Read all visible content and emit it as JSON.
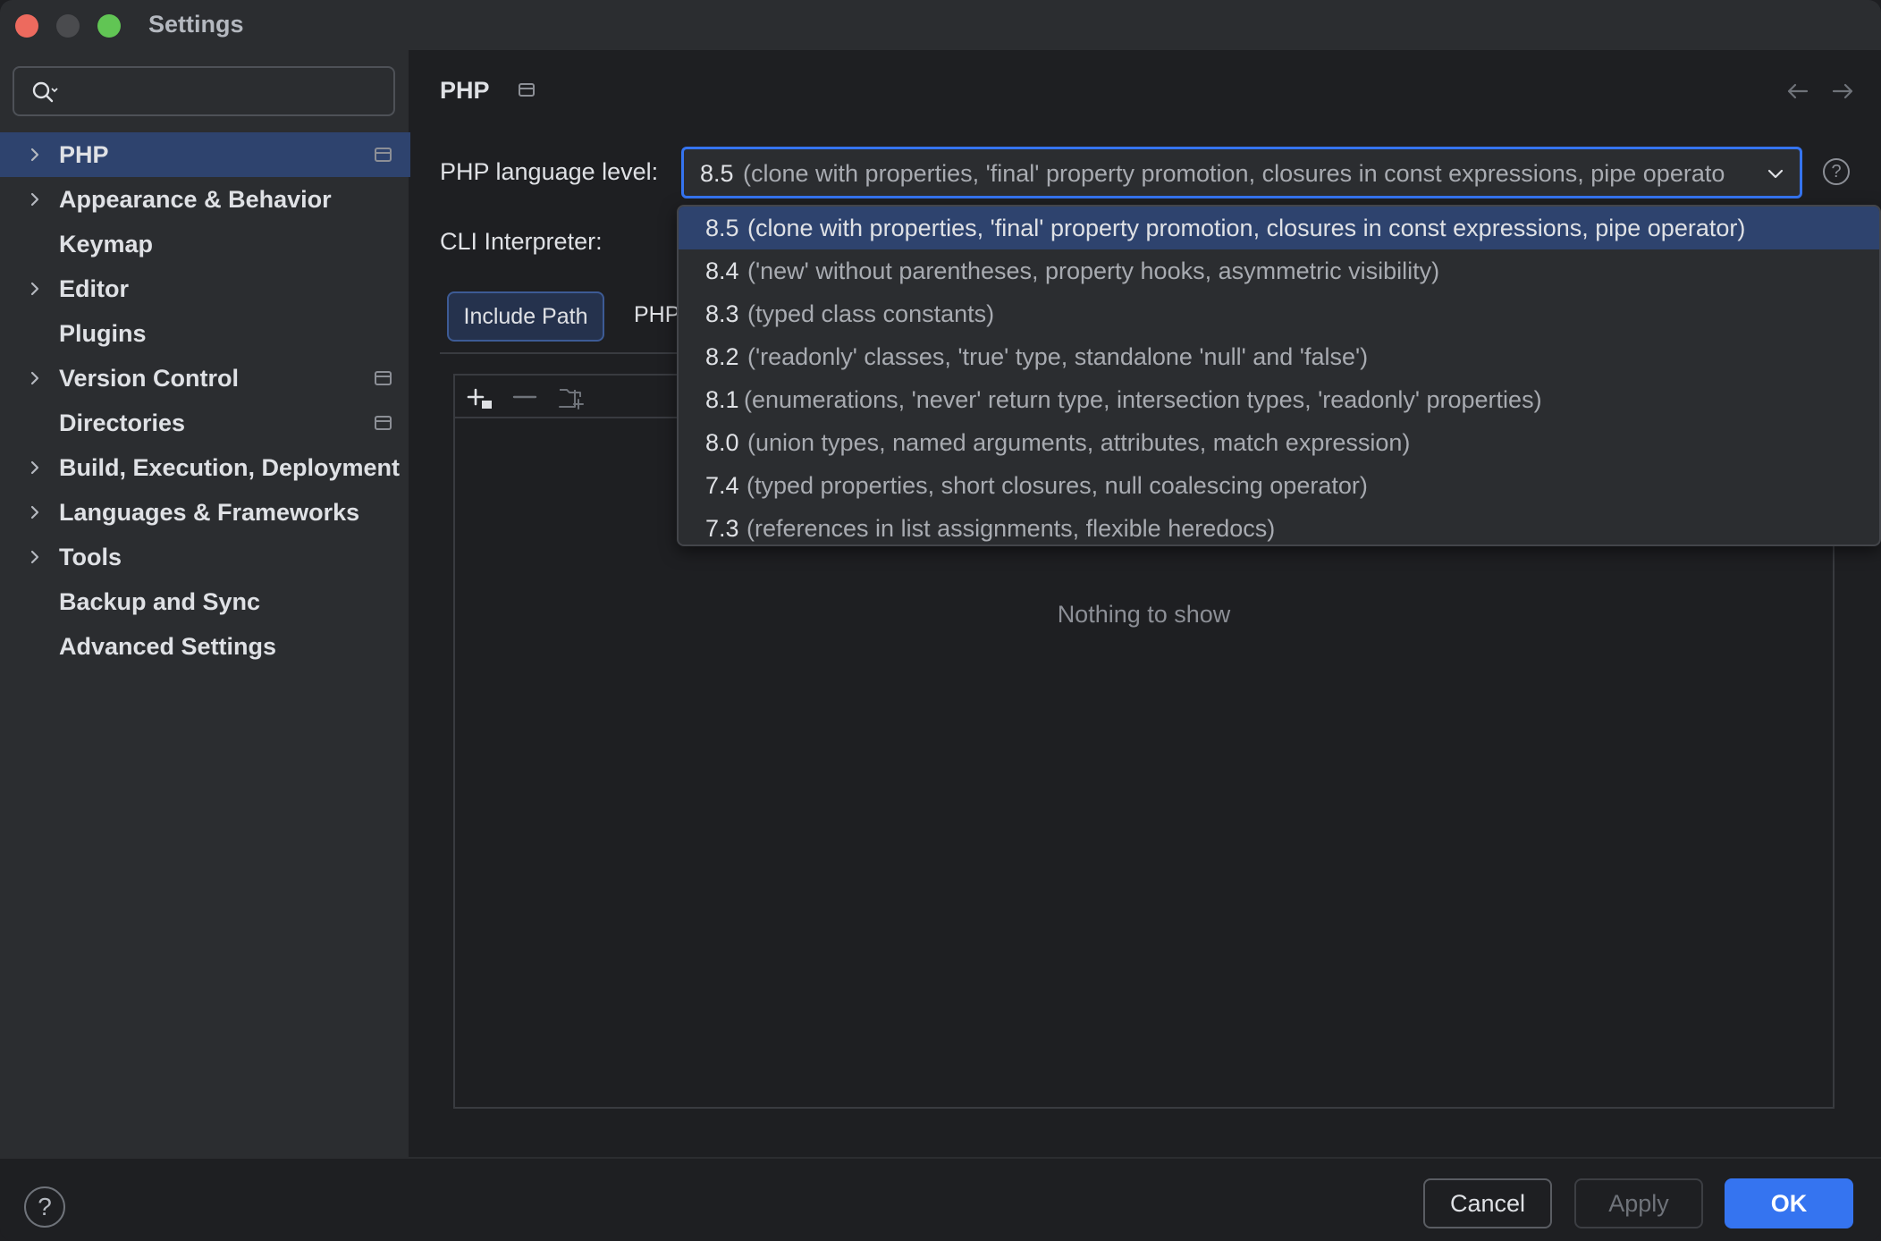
{
  "window": {
    "title": "Settings"
  },
  "sidebar": {
    "search": {
      "value": "",
      "placeholder": ""
    },
    "items": [
      {
        "label": "PHP",
        "expandable": true,
        "selected": true,
        "badge": true
      },
      {
        "label": "Appearance & Behavior",
        "expandable": true,
        "selected": false,
        "badge": false
      },
      {
        "label": "Keymap",
        "expandable": false,
        "selected": false,
        "badge": false
      },
      {
        "label": "Editor",
        "expandable": true,
        "selected": false,
        "badge": false
      },
      {
        "label": "Plugins",
        "expandable": false,
        "selected": false,
        "badge": false
      },
      {
        "label": "Version Control",
        "expandable": true,
        "selected": false,
        "badge": true
      },
      {
        "label": "Directories",
        "expandable": false,
        "selected": false,
        "badge": true
      },
      {
        "label": "Build, Execution, Deployment",
        "expandable": true,
        "selected": false,
        "badge": false
      },
      {
        "label": "Languages & Frameworks",
        "expandable": true,
        "selected": false,
        "badge": false
      },
      {
        "label": "Tools",
        "expandable": true,
        "selected": false,
        "badge": false
      },
      {
        "label": "Backup and Sync",
        "expandable": false,
        "selected": false,
        "badge": false
      },
      {
        "label": "Advanced Settings",
        "expandable": false,
        "selected": false,
        "badge": false
      }
    ]
  },
  "main": {
    "title": "PHP",
    "language_level_label": "PHP language level:",
    "language_level_value": {
      "version": "8.5",
      "description": "(clone with properties, 'final' property promotion, closures in const expressions, pipe operato"
    },
    "cli_interpreter_label": "CLI Interpreter:",
    "tabs": [
      {
        "label": "Include Path",
        "active": true
      },
      {
        "label": "PHP",
        "active": false
      }
    ],
    "empty_text": "Nothing to show"
  },
  "dropdown": {
    "options": [
      {
        "version": "8.5",
        "description": "(clone with properties, 'final' property promotion, closures in const expressions, pipe operator)",
        "selected": true
      },
      {
        "version": "8.4",
        "description": "('new' without parentheses, property hooks, asymmetric visibility)",
        "selected": false
      },
      {
        "version": "8.3",
        "description": "(typed class constants)",
        "selected": false
      },
      {
        "version": "8.2",
        "description": "('readonly' classes, 'true' type, standalone 'null' and 'false')",
        "selected": false
      },
      {
        "version": "8.1",
        "description": "(enumerations, 'never' return type, intersection types, 'readonly' properties)",
        "selected": false
      },
      {
        "version": "8.0",
        "description": "(union types, named arguments, attributes, match expression)",
        "selected": false
      },
      {
        "version": "7.4",
        "description": "(typed properties, short closures, null coalescing operator)",
        "selected": false
      },
      {
        "version": "7.3",
        "description": "(references in list assignments, flexible heredocs)",
        "selected": false
      }
    ]
  },
  "footer": {
    "help_label": "?",
    "cancel_label": "Cancel",
    "apply_label": "Apply",
    "ok_label": "OK"
  },
  "colors": {
    "accent": "#3574f0",
    "selection": "#2e436e",
    "background": "#1e1f22",
    "panel": "#2b2d30"
  }
}
